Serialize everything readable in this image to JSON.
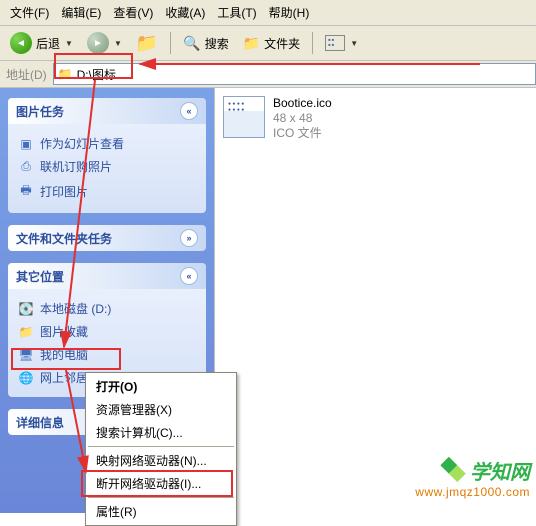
{
  "menu": {
    "file": "文件(F)",
    "edit": "编辑(E)",
    "view": "查看(V)",
    "fav": "收藏(A)",
    "tool": "工具(T)",
    "help": "帮助(H)"
  },
  "toolbar": {
    "back": "后退",
    "search": "搜索",
    "folders": "文件夹"
  },
  "address": {
    "label": "地址(D)",
    "value": "D:\\图标"
  },
  "panes": {
    "pic": {
      "title": "图片任务",
      "items": [
        "作为幻灯片查看",
        "联机订购照片",
        "打印图片"
      ]
    },
    "ff": {
      "title": "文件和文件夹任务"
    },
    "other": {
      "title": "其它位置",
      "items": [
        "本地磁盘 (D:)",
        "图片收藏",
        "我的电脑",
        "网上邻居"
      ]
    },
    "detail": {
      "title": "详细信息"
    }
  },
  "file": {
    "name": "Bootice.ico",
    "dim": "48 x 48",
    "type": "ICO 文件"
  },
  "context": {
    "open": "打开(O)",
    "res": "资源管理器(X)",
    "search": "搜索计算机(C)...",
    "map": "映射网络驱动器(N)...",
    "unmap": "断开网络驱动器(I)...",
    "prop": "属性(R)"
  },
  "watermark": {
    "name": "学知网",
    "url": "www.jmqz1000.com"
  }
}
